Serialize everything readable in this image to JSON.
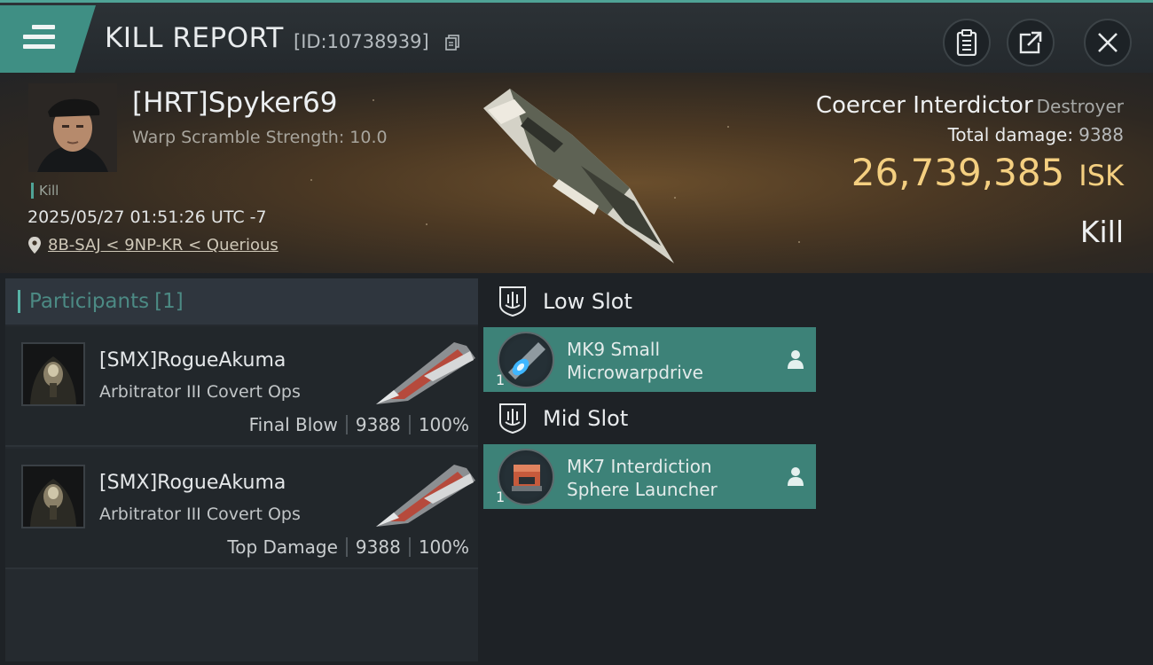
{
  "header": {
    "title": "KILL REPORT",
    "report_id": "[ID:10738939]",
    "buttons": [
      "clipboard-icon",
      "share-icon",
      "close-icon"
    ]
  },
  "victim": {
    "name": "[HRT]Spyker69",
    "warp_scramble": "Warp Scramble Strength: 10.0",
    "tag": "Kill",
    "datetime": "2025/05/27 01:51:26 UTC -7",
    "location": "8B-SAJ < 9NP-KR < Querious",
    "ship_name": "Coercer Interdictor",
    "ship_class": "Destroyer",
    "total_damage_label": "Total damage:",
    "total_damage": "9388",
    "isk_value": "26,739,385",
    "isk_unit": "ISK",
    "result": "Kill"
  },
  "participants": {
    "label": "Participants",
    "count": "[1]",
    "rows": [
      {
        "name": "[SMX]RogueAkuma",
        "ship": "Arbitrator III Covert Ops",
        "role": "Final Blow",
        "damage": "9388",
        "percent": "100%"
      },
      {
        "name": "[SMX]RogueAkuma",
        "ship": "Arbitrator III Covert Ops",
        "role": "Top Damage",
        "damage": "9388",
        "percent": "100%"
      }
    ]
  },
  "slots": [
    {
      "label": "Low Slot",
      "module": {
        "line1": "MK9 Small",
        "line2": "Microwarpdrive",
        "qty": "1"
      }
    },
    {
      "label": "Mid Slot",
      "module": {
        "line1": "MK7 Interdiction",
        "line2": "Sphere Launcher",
        "qty": "1"
      }
    }
  ],
  "colors": {
    "accent": "#4fa396",
    "isk": "#f4cf80",
    "module_bg": "#3d8278"
  }
}
